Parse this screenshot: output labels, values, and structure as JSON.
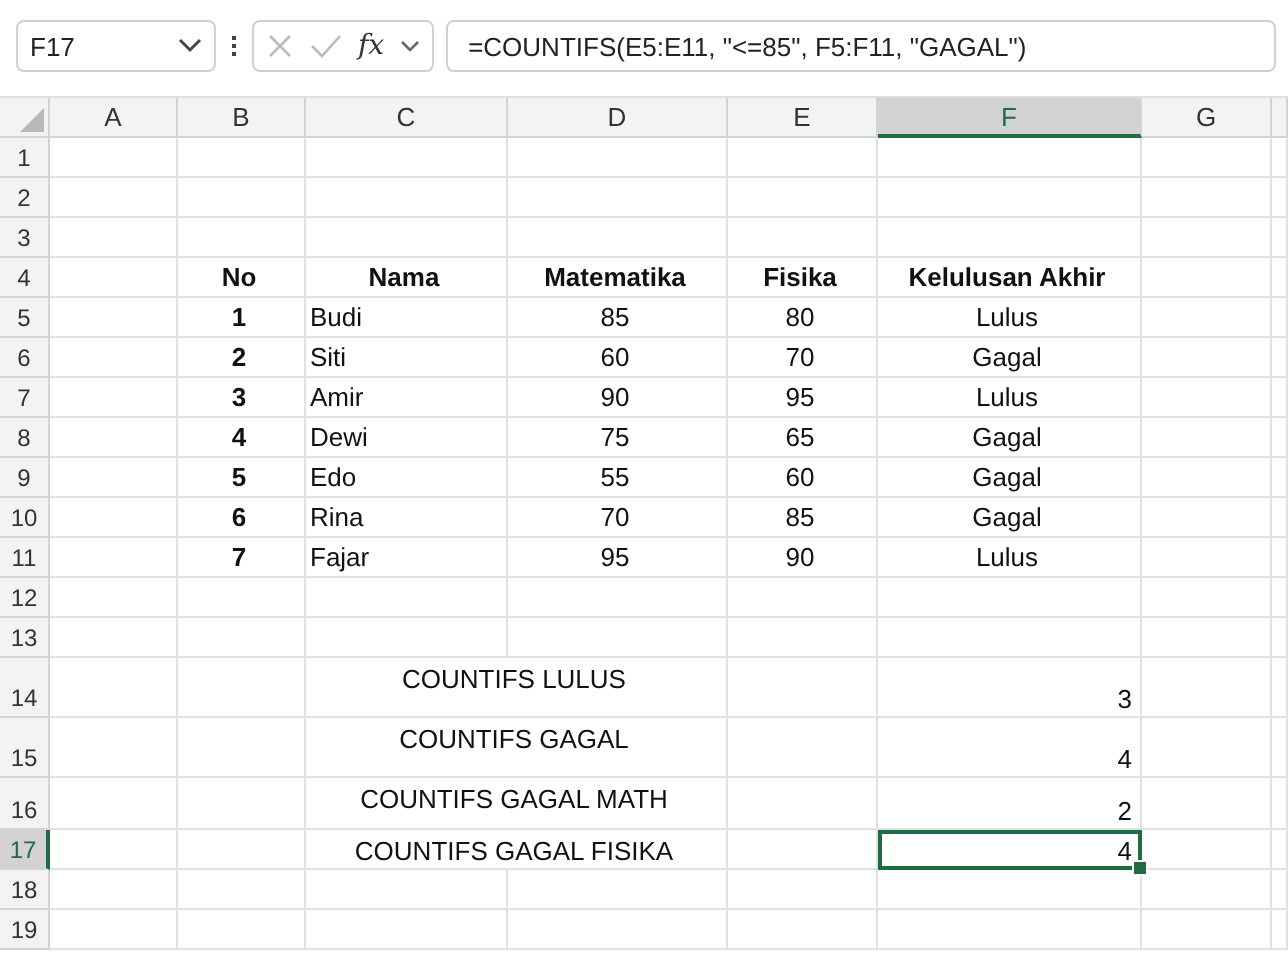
{
  "formula_bar": {
    "name_box": "F17",
    "insert_function": "fx",
    "formula": "=COUNTIFS(E5:E11, \"<=85\", F5:F11, \"GAGAL\")"
  },
  "columns": [
    {
      "label": "A",
      "selected": false
    },
    {
      "label": "B",
      "selected": false
    },
    {
      "label": "C",
      "selected": false
    },
    {
      "label": "D",
      "selected": false
    },
    {
      "label": "E",
      "selected": false
    },
    {
      "label": "F",
      "selected": true
    },
    {
      "label": "G",
      "selected": false
    }
  ],
  "rows": [
    {
      "label": "1",
      "selected": false,
      "cells": []
    },
    {
      "label": "2",
      "selected": false,
      "cells": []
    },
    {
      "label": "3",
      "selected": false,
      "cells": []
    },
    {
      "label": "4",
      "selected": false,
      "cells": {
        "B": {
          "kind": "bold",
          "text": "No",
          "selected": false
        },
        "C": {
          "kind": "bold",
          "text": "Nama",
          "selected": false
        },
        "D": {
          "kind": "bold",
          "text": "Matematika",
          "selected": false
        },
        "E": {
          "kind": "bold",
          "text": "Fisika",
          "selected": false
        },
        "F": {
          "kind": "bold",
          "text": "Kelulusan Akhir",
          "selected": false
        }
      }
    },
    {
      "label": "5",
      "selected": false,
      "cells": {
        "B": {
          "kind": "bold",
          "text": "1",
          "selected": false
        },
        "C": {
          "kind": "name",
          "text": "Budi",
          "selected": false
        },
        "D": {
          "kind": "value",
          "text": "85",
          "selected": false
        },
        "E": {
          "kind": "value",
          "text": "80",
          "selected": false
        },
        "F": {
          "kind": "value",
          "text": "Lulus",
          "selected": false
        }
      }
    },
    {
      "label": "6",
      "selected": false,
      "cells": {
        "B": {
          "kind": "bold",
          "text": "2",
          "selected": false
        },
        "C": {
          "kind": "name",
          "text": "Siti",
          "selected": false
        },
        "D": {
          "kind": "value",
          "text": "60",
          "selected": false
        },
        "E": {
          "kind": "value",
          "text": "70",
          "selected": false
        },
        "F": {
          "kind": "value",
          "text": "Gagal",
          "selected": false
        }
      }
    },
    {
      "label": "7",
      "selected": false,
      "cells": {
        "B": {
          "kind": "bold",
          "text": "3",
          "selected": false
        },
        "C": {
          "kind": "name",
          "text": "Amir",
          "selected": false
        },
        "D": {
          "kind": "value",
          "text": "90",
          "selected": false
        },
        "E": {
          "kind": "value",
          "text": "95",
          "selected": false
        },
        "F": {
          "kind": "value",
          "text": "Lulus",
          "selected": false
        }
      }
    },
    {
      "label": "8",
      "selected": false,
      "cells": {
        "B": {
          "kind": "bold",
          "text": "4",
          "selected": false
        },
        "C": {
          "kind": "name",
          "text": "Dewi",
          "selected": false
        },
        "D": {
          "kind": "value",
          "text": "75",
          "selected": false
        },
        "E": {
          "kind": "value",
          "text": "65",
          "selected": false
        },
        "F": {
          "kind": "value",
          "text": "Gagal",
          "selected": false
        }
      }
    },
    {
      "label": "9",
      "selected": false,
      "cells": {
        "B": {
          "kind": "bold",
          "text": "5",
          "selected": false
        },
        "C": {
          "kind": "name",
          "text": "Edo",
          "selected": false
        },
        "D": {
          "kind": "value",
          "text": "55",
          "selected": false
        },
        "E": {
          "kind": "value",
          "text": "60",
          "selected": false
        },
        "F": {
          "kind": "value",
          "text": "Gagal",
          "selected": false
        }
      }
    },
    {
      "label": "10",
      "selected": false,
      "cells": {
        "B": {
          "kind": "bold",
          "text": "6",
          "selected": false
        },
        "C": {
          "kind": "name",
          "text": "Rina",
          "selected": false
        },
        "D": {
          "kind": "value",
          "text": "70",
          "selected": false
        },
        "E": {
          "kind": "value",
          "text": "85",
          "selected": false
        },
        "F": {
          "kind": "value",
          "text": "Gagal",
          "selected": false
        }
      }
    },
    {
      "label": "11",
      "selected": false,
      "cells": {
        "B": {
          "kind": "bold",
          "text": "7",
          "selected": false
        },
        "C": {
          "kind": "name",
          "text": "Fajar",
          "selected": false
        },
        "D": {
          "kind": "value",
          "text": "95",
          "selected": false
        },
        "E": {
          "kind": "value",
          "text": "90",
          "selected": false
        },
        "F": {
          "kind": "value",
          "text": "Lulus",
          "selected": false
        }
      }
    },
    {
      "label": "12",
      "selected": false,
      "cells": {}
    },
    {
      "label": "13",
      "selected": false,
      "cells": {}
    },
    {
      "label": "14",
      "selected": false,
      "cells": {
        "C": {
          "kind": "label",
          "text": "COUNTIFS LULUS",
          "selected": false
        },
        "F": {
          "kind": "count",
          "text": "3",
          "selected": false
        }
      }
    },
    {
      "label": "15",
      "selected": false,
      "cells": {
        "C": {
          "kind": "label",
          "text": "COUNTIFS GAGAL",
          "selected": false
        },
        "F": {
          "kind": "count",
          "text": "4",
          "selected": false
        }
      }
    },
    {
      "label": "16",
      "selected": false,
      "cells": {
        "C": {
          "kind": "label",
          "text": "COUNTIFS GAGAL MATH",
          "selected": false
        },
        "F": {
          "kind": "count",
          "text": "2",
          "selected": false
        }
      }
    },
    {
      "label": "17",
      "selected": true,
      "cells": {
        "C": {
          "kind": "label",
          "text": "COUNTIFS GAGAL FISIKA",
          "selected": false
        },
        "F": {
          "kind": "count",
          "text": "4",
          "selected": true
        }
      }
    },
    {
      "label": "18",
      "selected": false,
      "cells": []
    },
    {
      "label": "19",
      "selected": false,
      "cells": []
    }
  ]
}
